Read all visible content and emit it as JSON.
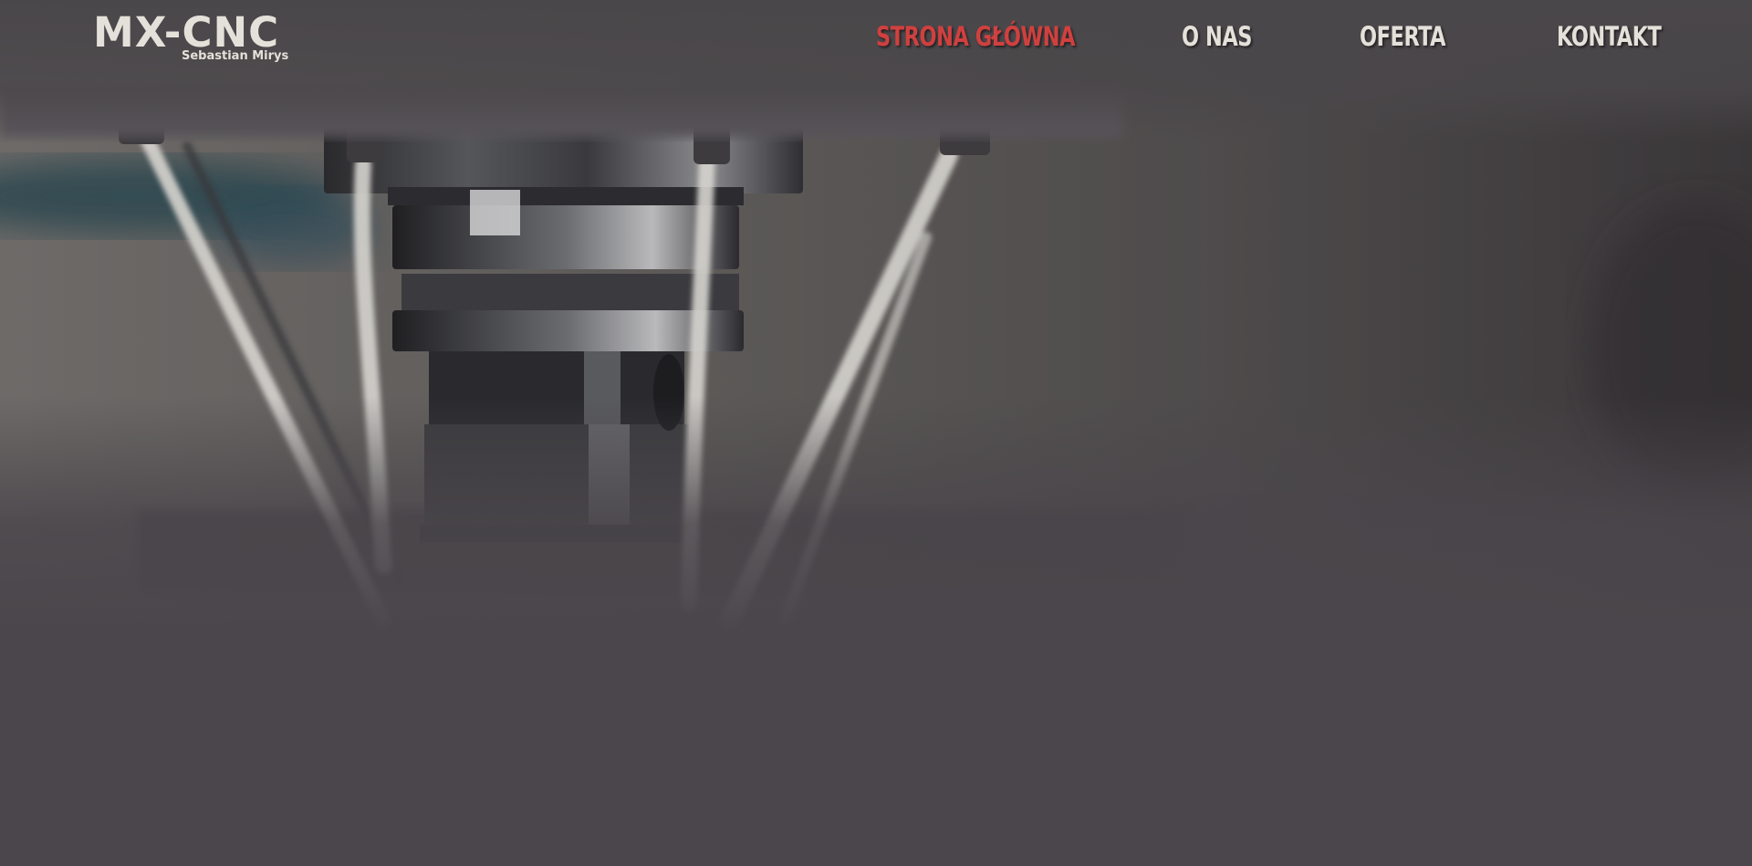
{
  "logo": {
    "title": "MX-CNC",
    "subtitle": "Sebastian Mirys"
  },
  "nav": {
    "items": [
      {
        "label": "STRONA GŁÓWNA",
        "active": true
      },
      {
        "label": "O NAS",
        "active": false
      },
      {
        "label": "OFERTA",
        "active": false
      },
      {
        "label": "KONTAKT",
        "active": false
      }
    ]
  },
  "colors": {
    "accent": "#d0403f",
    "nav_text": "#e4e1da",
    "background": "#4a464b"
  },
  "hero": {
    "image": "cnc-milling-spindle-with-coolant-background"
  }
}
